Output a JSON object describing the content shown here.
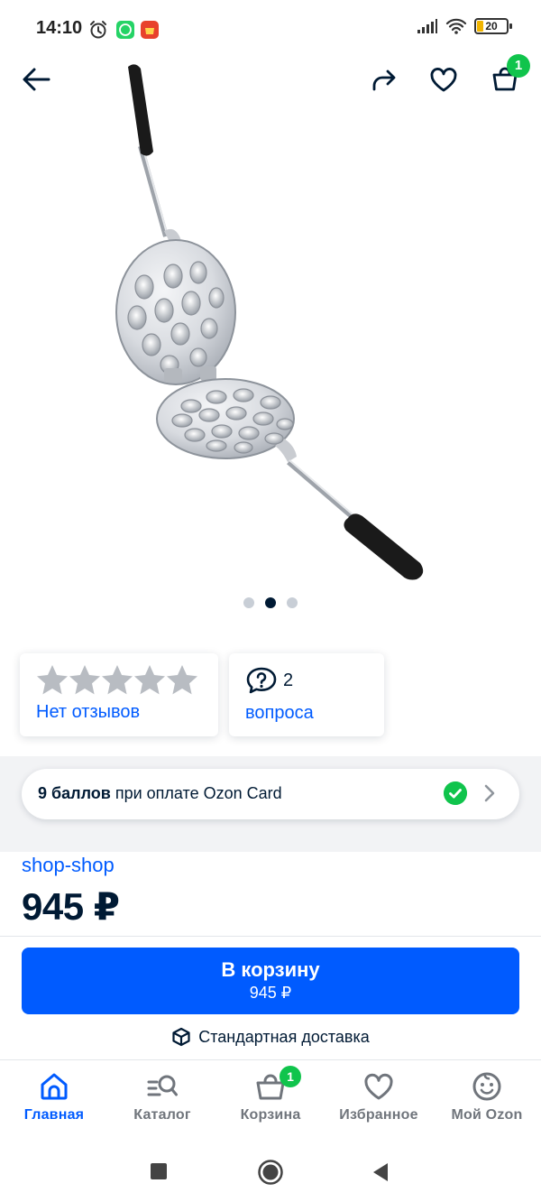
{
  "status_bar": {
    "time": "14:10",
    "battery": "20"
  },
  "top_nav": {
    "cart_count": "1"
  },
  "gallery": {
    "pages": 3,
    "active_index": 1
  },
  "reviews": {
    "stars_filled": 0,
    "stars_total": 5,
    "label": "Нет отзывов"
  },
  "questions": {
    "count": "2",
    "label": "вопроса"
  },
  "bonus": {
    "bold": "9 баллов",
    "text": " при оплате Ozon Card"
  },
  "seller": "shop-shop",
  "price": "945 ₽",
  "cart_button": {
    "title": "В корзину",
    "price": "945 ₽"
  },
  "delivery": "Стандартная доставка",
  "tabs": [
    {
      "label": "Главная",
      "icon": "home-icon",
      "active": true
    },
    {
      "label": "Каталог",
      "icon": "catalog-search-icon",
      "active": false
    },
    {
      "label": "Корзина",
      "icon": "basket-icon",
      "active": false,
      "badge": "1"
    },
    {
      "label": "Избранное",
      "icon": "heart-icon",
      "active": false
    },
    {
      "label": "Мой Ozon",
      "icon": "smiley-icon",
      "active": false
    }
  ],
  "colors": {
    "accent": "#005bff",
    "success": "#10c44c",
    "text": "#001a34",
    "muted": "#70757c"
  }
}
